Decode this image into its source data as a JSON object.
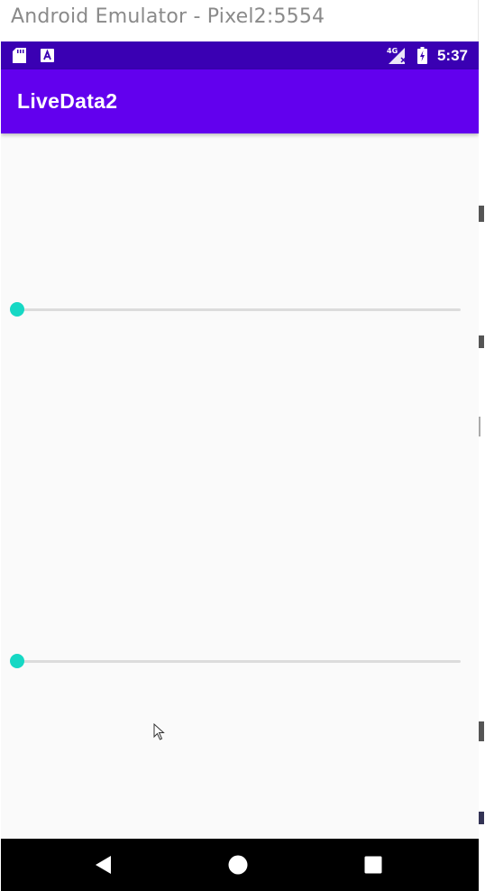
{
  "window": {
    "title": "Android Emulator - Pixel2:5554"
  },
  "status_bar": {
    "time": "5:37",
    "network": "4G",
    "icons": [
      "sd-card-icon",
      "a-notification-icon",
      "signal-icon",
      "battery-charging-icon"
    ]
  },
  "app_bar": {
    "title": "LiveData2"
  },
  "seekbars": [
    {
      "name": "seekbar-1",
      "progress": 0
    },
    {
      "name": "seekbar-2",
      "progress": 0
    }
  ],
  "nav_bar": {
    "buttons": [
      "back-icon",
      "home-icon",
      "recents-icon"
    ]
  },
  "colors": {
    "status_bar": "#3a00b3",
    "app_bar": "#6200ee",
    "seek_thumb": "#16d8c4",
    "seek_track": "#dcdcdc"
  }
}
